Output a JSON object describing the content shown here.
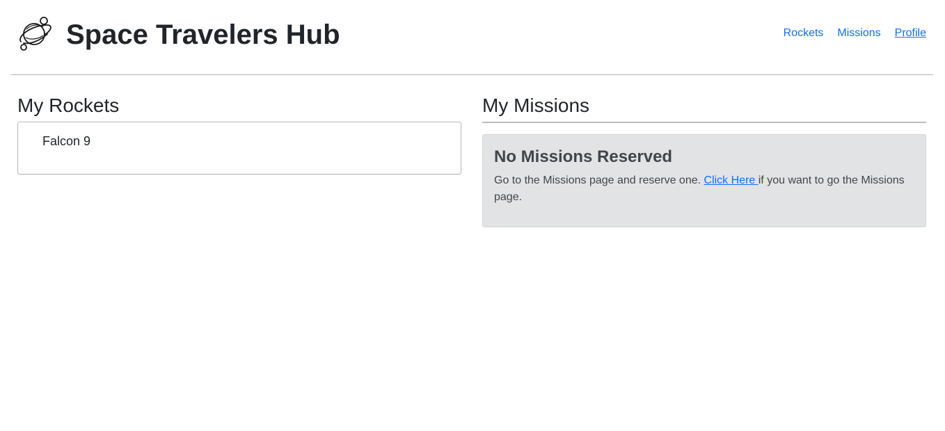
{
  "header": {
    "brand_title": "Space Travelers Hub",
    "logo_icon": "planet-icon",
    "nav": [
      {
        "label": "Rockets",
        "active": false
      },
      {
        "label": "Missions",
        "active": false
      },
      {
        "label": "Profile",
        "active": true
      }
    ]
  },
  "rockets": {
    "title": "My Rockets",
    "items": [
      "Falcon 9"
    ]
  },
  "missions": {
    "title": "My Missions",
    "empty": {
      "heading": "No Missions Reserved",
      "text_before": "Go to the Missions page and reserve one. ",
      "link_label": "Click Here ",
      "text_after": "if you want to go the Missions page."
    }
  },
  "colors": {
    "link": "#0d6efd",
    "empty_bg": "#e2e3e5",
    "text": "#212529"
  }
}
